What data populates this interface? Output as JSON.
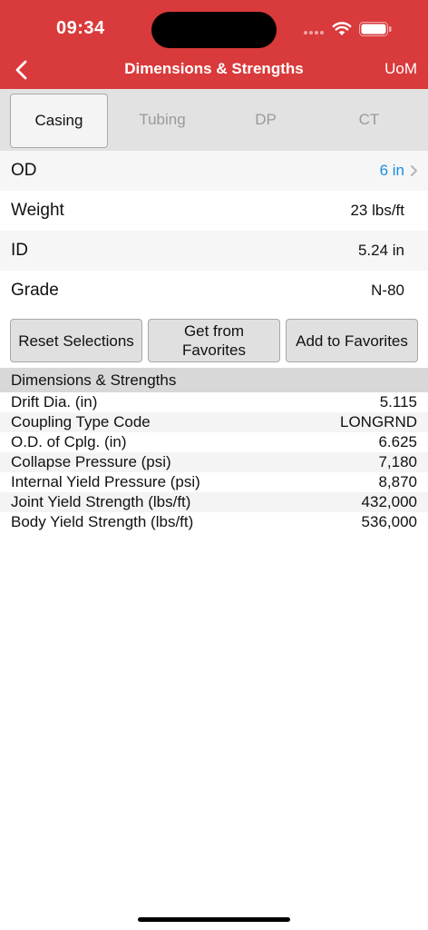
{
  "status_bar": {
    "time": "09:34"
  },
  "nav": {
    "title": "Dimensions & Strengths",
    "right_button": "UoM",
    "back_icon": "chevron-left-icon"
  },
  "tabs": [
    {
      "label": "Casing",
      "active": true
    },
    {
      "label": "Tubing",
      "active": false
    },
    {
      "label": "DP",
      "active": false
    },
    {
      "label": "CT",
      "active": false
    }
  ],
  "properties": [
    {
      "label": "OD",
      "value": "6 in",
      "link": true
    },
    {
      "label": "Weight",
      "value": "23 lbs/ft"
    },
    {
      "label": "ID",
      "value": "5.24 in"
    },
    {
      "label": "Grade",
      "value": "N-80"
    }
  ],
  "actions": {
    "reset": "Reset Selections",
    "get_fav_line1": "Get from",
    "get_fav_line2": "Favorites",
    "add_fav": "Add to Favorites"
  },
  "section": {
    "title": "Dimensions & Strengths",
    "rows": [
      {
        "label": "Drift Dia. (in)",
        "value": "5.115"
      },
      {
        "label": "Coupling Type Code",
        "value": "LONGRND"
      },
      {
        "label": "O.D. of Cplg. (in)",
        "value": "6.625"
      },
      {
        "label": "Collapse Pressure (psi)",
        "value": "7,180"
      },
      {
        "label": "Internal Yield Pressure (psi)",
        "value": "8,870"
      },
      {
        "label": "Joint Yield Strength (lbs/ft)",
        "value": "432,000"
      },
      {
        "label": "Body Yield Strength (lbs/ft)",
        "value": "536,000"
      }
    ]
  },
  "colors": {
    "header": "#d93a3b",
    "link": "#1a8ee0"
  }
}
